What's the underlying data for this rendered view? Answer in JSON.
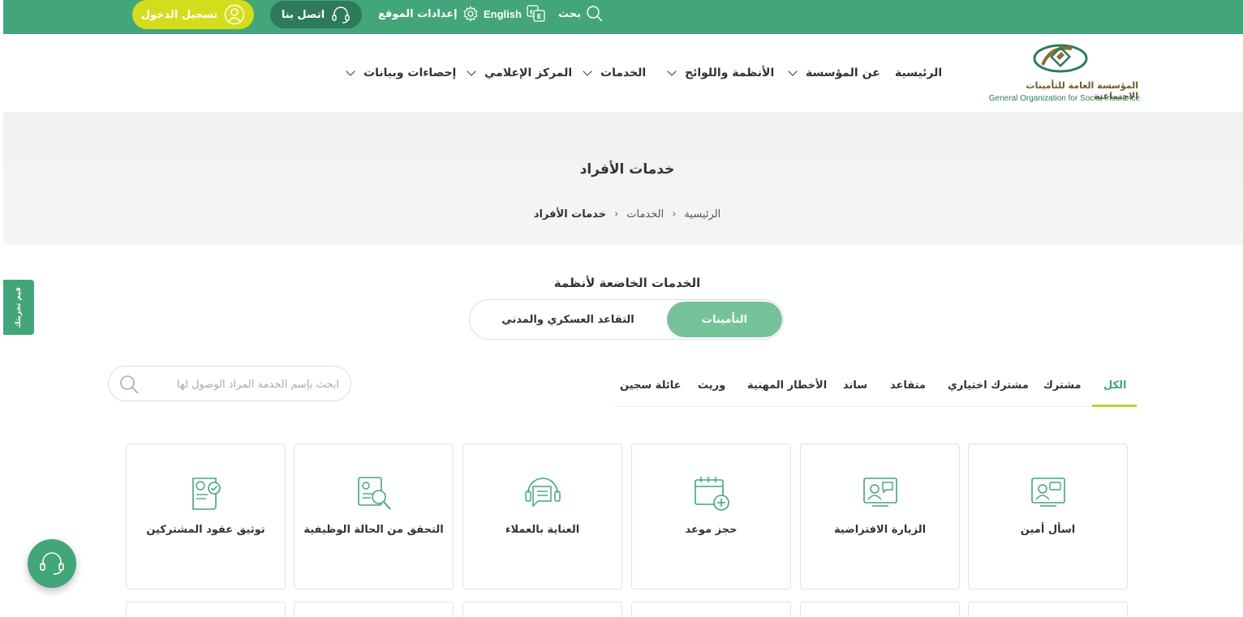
{
  "topbar": {
    "login_label": "تسجيل الدخول",
    "contact_label": "اتصل بنا",
    "settings_label": "إعدادات الموقع",
    "language_label": "English",
    "search_label": "بحث"
  },
  "logo": {
    "arabic": "المؤسسة العامة للتأمينات الاجتماعية",
    "english": "General Organization for Social Insurance"
  },
  "nav": {
    "home": "الرئيسية",
    "about": "عن المؤسسة",
    "regulations": "الأنظمة واللوائح",
    "services": "الخدمات",
    "media": "المركز الإعلامي",
    "stats": "إحصاءات وبيانات"
  },
  "hero": {
    "title": "خدمات الأفراد",
    "breadcrumb": [
      "الرئيسية",
      "الخدمات",
      "خدمات الأفراد"
    ]
  },
  "side_tab": "قيم تجربتك",
  "section": {
    "title": "الخدمات الخاضعة لأنظمة",
    "switch_active": "التأمينات",
    "switch_inactive": "التقاعد العسكري والمدني"
  },
  "search": {
    "placeholder": "ابحث بإسم الخدمة المراد الوصول لها"
  },
  "filters": [
    "الكل",
    "مشترك",
    "مشترك اختياري",
    "متقاعد",
    "ساند",
    "الأخطار المهنية",
    "وريث",
    "عائلة سجين"
  ],
  "cards": [
    {
      "label": "اسأل أمين",
      "icon": "video-chat-icon"
    },
    {
      "label": "الزيارة الافتراضية",
      "icon": "virtual-visit-icon"
    },
    {
      "label": "حجز موعد",
      "icon": "calendar-add-icon"
    },
    {
      "label": "العناية بالعملاء",
      "icon": "customer-care-icon"
    },
    {
      "label": "التحقق من الحالة الوظيفية",
      "icon": "document-search-icon"
    },
    {
      "label": "توثيق عقود المشتركين",
      "icon": "contract-verify-icon"
    }
  ],
  "colors": {
    "primary": "#43a57a",
    "accent": "#d4dd1c",
    "dark_green": "#2d7a5c",
    "switch_active": "#76c39a"
  }
}
